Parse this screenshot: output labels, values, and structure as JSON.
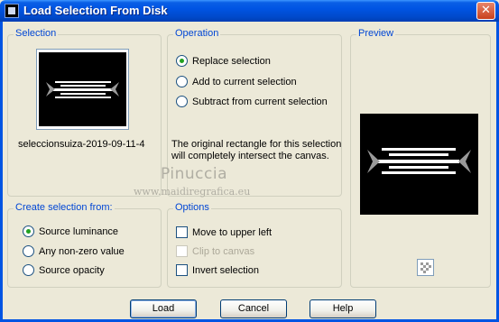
{
  "window": {
    "title": "Load Selection From Disk",
    "close_symbol": "✕"
  },
  "selection": {
    "legend": "Selection",
    "filename": "seleccionsuiza-2019-09-11-4"
  },
  "operation": {
    "legend": "Operation",
    "options": [
      "Replace selection",
      "Add to current selection",
      "Subtract from current selection"
    ],
    "selected": "Replace selection",
    "note_line1": "The original rectangle for this selection",
    "note_line2": "will completely intersect the canvas."
  },
  "preview": {
    "legend": "Preview"
  },
  "create_from": {
    "legend": "Create selection from:",
    "options": [
      "Source luminance",
      "Any non-zero value",
      "Source opacity"
    ],
    "selected": "Source luminance"
  },
  "options": {
    "legend": "Options",
    "move_upper_left": "Move to upper left",
    "clip_to_canvas": "Clip to canvas",
    "invert_selection": "Invert selection"
  },
  "watermark": {
    "name": "Pinuccia",
    "url": "www.maidiregrafica.eu"
  },
  "buttons": {
    "load": "Load",
    "cancel": "Cancel",
    "help": "Help"
  },
  "icons": {
    "app": "paint-shop-icon",
    "close": "close-icon",
    "pattern": "checker-pattern-icon"
  }
}
